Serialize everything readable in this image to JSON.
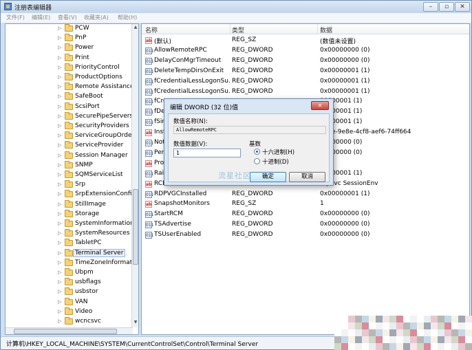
{
  "window": {
    "title": "注册表编辑器",
    "min_icon": "–",
    "max_icon": "▫",
    "close_icon": "✕"
  },
  "menu": [
    "文件(F)",
    "编辑(E)",
    "查看(V)",
    "收藏夹(A)",
    "帮助(H)"
  ],
  "tree": {
    "items": [
      "PCW",
      "PnP",
      "Power",
      "Print",
      "PriorityControl",
      "ProductOptions",
      "Remote Assistance",
      "SafeBoot",
      "ScsiPort",
      "SecurePipeServers",
      "SecurityProviders",
      "ServiceGroupOrder",
      "ServiceProvider",
      "Session Manager",
      "SNMP",
      "SQMServiceList",
      "Srp",
      "SrpExtensionConfig",
      "StillImage",
      "Storage",
      "SystemInformation",
      "SystemResources",
      "TabletPC",
      "Terminal Server",
      "TimeZoneInformation",
      "Ubpm",
      "usbflags",
      "usbstor",
      "VAN",
      "Video",
      "wcncsvc"
    ],
    "selected": "Terminal Server"
  },
  "list": {
    "headers": {
      "name": "名称",
      "type": "类型",
      "data": "数据"
    },
    "rows": [
      {
        "icon": "string-value-icon",
        "name": "(默认)",
        "type": "REG_SZ",
        "data": "(数值未设置)"
      },
      {
        "icon": "dword-value-icon",
        "name": "AllowRemoteRPC",
        "type": "REG_DWORD",
        "data": "0x00000000 (0)"
      },
      {
        "icon": "dword-value-icon",
        "name": "DelayConMgrTimeout",
        "type": "REG_DWORD",
        "data": "0x00000000 (0)"
      },
      {
        "icon": "dword-value-icon",
        "name": "DeleteTempDirsOnExit",
        "type": "REG_DWORD",
        "data": "0x00000001 (1)"
      },
      {
        "icon": "dword-value-icon",
        "name": "fCredentialLessLogonSu...",
        "type": "REG_DWORD",
        "data": "0x00000001 (1)"
      },
      {
        "icon": "dword-value-icon",
        "name": "fCredentialLessLogonSu...",
        "type": "REG_DWORD",
        "data": "0x00000001 (1)"
      },
      {
        "icon": "dword-value-icon",
        "name": "fCre",
        "type": "",
        "data": "00000001 (1)"
      },
      {
        "icon": "dword-value-icon",
        "name": "fDen",
        "type": "",
        "data": "00000001 (1)"
      },
      {
        "icon": "dword-value-icon",
        "name": "fSing",
        "type": "",
        "data": "00000001 (1)"
      },
      {
        "icon": "string-value-icon",
        "name": "Insta",
        "type": "",
        "data": "79ae-9e8e-4cf8-aef6-74ff664"
      },
      {
        "icon": "dword-value-icon",
        "name": "Notif",
        "type": "",
        "data": "00000000 (0)"
      },
      {
        "icon": "dword-value-icon",
        "name": "PerS",
        "type": "",
        "data": "00000000 (0)"
      },
      {
        "icon": "string-value-icon",
        "name": "Prod",
        "type": "",
        "data": ""
      },
      {
        "icon": "dword-value-icon",
        "name": "RailS",
        "type": "",
        "data": "00000001 (1)"
      },
      {
        "icon": "string-value-icon",
        "name": "RCD",
        "type": "",
        "data": "ropSvc SessionEnv"
      },
      {
        "icon": "dword-value-icon",
        "name": "RDPVGCInstalled",
        "type": "REG_DWORD",
        "data": "0x00000001 (1)"
      },
      {
        "icon": "string-value-icon",
        "name": "SnapshotMonitors",
        "type": "REG_SZ",
        "data": "1"
      },
      {
        "icon": "dword-value-icon",
        "name": "StartRCM",
        "type": "REG_DWORD",
        "data": "0x00000000 (0)"
      },
      {
        "icon": "dword-value-icon",
        "name": "TSAdvertise",
        "type": "REG_DWORD",
        "data": "0x00000000 (0)"
      },
      {
        "icon": "dword-value-icon",
        "name": "TSUserEnabled",
        "type": "REG_DWORD",
        "data": "0x00000000 (0)"
      }
    ]
  },
  "status": "计算机\\HKEY_LOCAL_MACHINE\\SYSTEM\\CurrentControlSet\\Control\\Terminal Server",
  "dialog": {
    "title": "编辑 DWORD (32 位)值",
    "close_icon": "✕",
    "value_name_label": "数值名称(N):",
    "value_name": "AllowRemoteRPC",
    "value_data_label": "数值数据(V):",
    "value_data": "1",
    "base_label": "基数",
    "hex_label": "十六进制(H)",
    "dec_label": "十进制(D)",
    "selected_base": "hex",
    "ok": "确定",
    "cancel": "取消"
  },
  "watermark": "流星社区",
  "icon_glyphs": {
    "string-value-icon": "ab",
    "dword-value-icon": "011"
  }
}
